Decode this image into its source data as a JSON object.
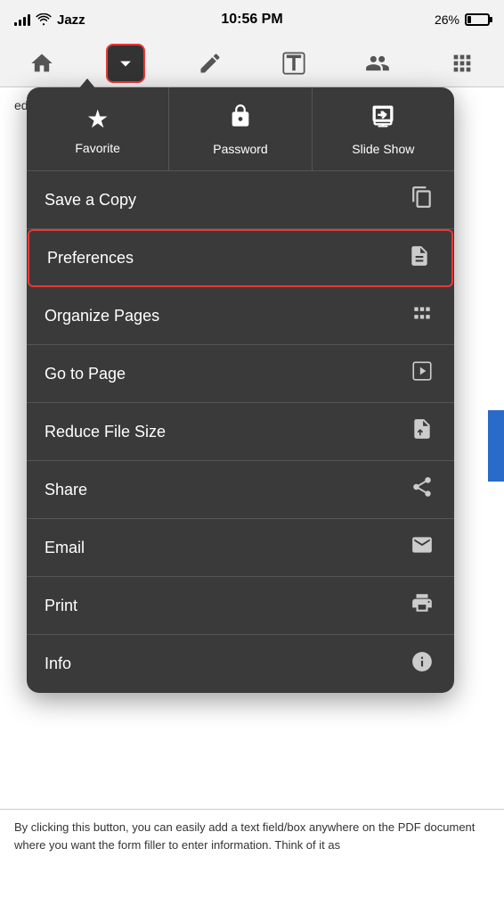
{
  "status_bar": {
    "carrier": "Jazz",
    "time": "10:56 PM",
    "battery": "26%"
  },
  "toolbar": {
    "home_label": "home",
    "dropdown_label": "dropdown",
    "pen_label": "pen",
    "text_label": "text",
    "user_label": "user",
    "grid_label": "grid"
  },
  "bg_content": {
    "text": "edit, and fill out multiple forms in any PDF document."
  },
  "dropdown": {
    "favorite_label": "Favorite",
    "password_label": "Password",
    "slideshow_label": "Slide Show",
    "save_copy_label": "Save a Copy",
    "preferences_label": "Preferences",
    "organize_pages_label": "Organize Pages",
    "go_to_page_label": "Go to Page",
    "reduce_file_size_label": "Reduce File Size",
    "share_label": "Share",
    "email_label": "Email",
    "print_label": "Print",
    "info_label": "Info"
  },
  "bottom_content": {
    "text": "By clicking this button, you can easily add a text field/box anywhere on the PDF document where you want the form filler to enter information. Think of it as"
  }
}
